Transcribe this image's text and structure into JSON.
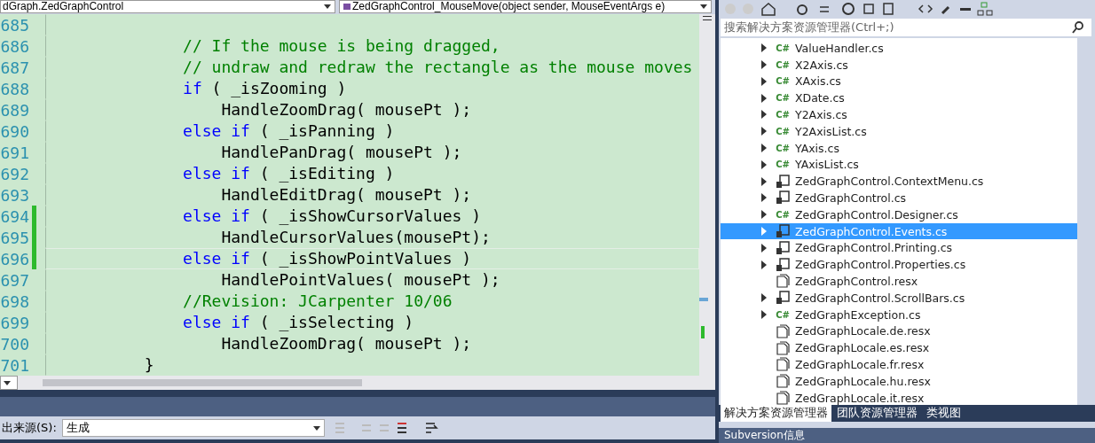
{
  "editor": {
    "type_dropdown": "dGraph.ZedGraphControl",
    "member_dropdown": "ZedGraphControl_MouseMove(object sender, MouseEventArgs e)",
    "lines": [
      {
        "number": "685",
        "changed": false,
        "current": false
      },
      {
        "number": "686",
        "changed": false,
        "current": false,
        "tokens": [
          {
            "kind": "comment",
            "text": "            // If the mouse is being dragged,"
          }
        ]
      },
      {
        "number": "687",
        "changed": false,
        "current": false,
        "tokens": [
          {
            "kind": "comment",
            "text": "            // undraw and redraw the rectangle as the mouse moves"
          }
        ]
      },
      {
        "number": "688",
        "changed": false,
        "current": false,
        "tokens": [
          {
            "kind": "keyword",
            "text": "            if"
          },
          {
            "kind": "plain",
            "text": " ( _isZooming )"
          }
        ]
      },
      {
        "number": "689",
        "changed": false,
        "current": false,
        "tokens": [
          {
            "kind": "plain",
            "text": "                HandleZoomDrag( mousePt );"
          }
        ]
      },
      {
        "number": "690",
        "changed": false,
        "current": false,
        "tokens": [
          {
            "kind": "keyword",
            "text": "            else if"
          },
          {
            "kind": "plain",
            "text": " ( _isPanning )"
          }
        ]
      },
      {
        "number": "691",
        "changed": false,
        "current": false,
        "tokens": [
          {
            "kind": "plain",
            "text": "                HandlePanDrag( mousePt );"
          }
        ]
      },
      {
        "number": "692",
        "changed": false,
        "current": false,
        "tokens": [
          {
            "kind": "keyword",
            "text": "            else if"
          },
          {
            "kind": "plain",
            "text": " ( _isEditing )"
          }
        ]
      },
      {
        "number": "693",
        "changed": false,
        "current": false,
        "tokens": [
          {
            "kind": "plain",
            "text": "                HandleEditDrag( mousePt );"
          }
        ]
      },
      {
        "number": "694",
        "changed": true,
        "current": false,
        "tokens": [
          {
            "kind": "keyword",
            "text": "            else if"
          },
          {
            "kind": "plain",
            "text": " ( _isShowCursorValues )"
          }
        ]
      },
      {
        "number": "695",
        "changed": true,
        "current": false,
        "tokens": [
          {
            "kind": "plain",
            "text": "                HandleCursorValues(mousePt);"
          }
        ]
      },
      {
        "number": "696",
        "changed": true,
        "current": true,
        "tokens": [
          {
            "kind": "keyword",
            "text": "            else if"
          },
          {
            "kind": "plain",
            "text": " ( _isShowPointValues )"
          }
        ]
      },
      {
        "number": "697",
        "changed": false,
        "current": false,
        "tokens": [
          {
            "kind": "plain",
            "text": "                HandlePointValues( mousePt );"
          }
        ]
      },
      {
        "number": "698",
        "changed": false,
        "current": false,
        "tokens": [
          {
            "kind": "comment",
            "text": "            //Revision: JCarpenter 10/06"
          }
        ]
      },
      {
        "number": "699",
        "changed": false,
        "current": false,
        "tokens": [
          {
            "kind": "keyword",
            "text": "            else if"
          },
          {
            "kind": "plain",
            "text": " ( _isSelecting )"
          }
        ]
      },
      {
        "number": "700",
        "changed": false,
        "current": false,
        "tokens": [
          {
            "kind": "plain",
            "text": "                HandleZoomDrag( mousePt );"
          }
        ]
      },
      {
        "number": "701",
        "changed": false,
        "current": false,
        "tokens": [
          {
            "kind": "plain",
            "text": "        }"
          }
        ]
      }
    ]
  },
  "output": {
    "source_label": "出来源(S):",
    "source_value": "生成"
  },
  "solution_explorer": {
    "search": {
      "placeholder": "搜索解决方案资源管理器(Ctrl+;)"
    },
    "items": [
      {
        "name": "ValueHandler.cs",
        "kind": "csharp",
        "icon_text": "C#",
        "expandable": true,
        "selected": false
      },
      {
        "name": "X2Axis.cs",
        "kind": "csharp",
        "icon_text": "C#",
        "expandable": true,
        "selected": false
      },
      {
        "name": "XAxis.cs",
        "kind": "csharp",
        "icon_text": "C#",
        "expandable": true,
        "selected": false
      },
      {
        "name": "XDate.cs",
        "kind": "csharp",
        "icon_text": "C#",
        "expandable": true,
        "selected": false
      },
      {
        "name": "Y2Axis.cs",
        "kind": "csharp",
        "icon_text": "C#",
        "expandable": true,
        "selected": false
      },
      {
        "name": "Y2AxisList.cs",
        "kind": "csharp",
        "icon_text": "C#",
        "expandable": true,
        "selected": false
      },
      {
        "name": "YAxis.cs",
        "kind": "csharp",
        "icon_text": "C#",
        "expandable": true,
        "selected": false
      },
      {
        "name": "YAxisList.cs",
        "kind": "csharp",
        "icon_text": "C#",
        "expandable": true,
        "selected": false
      },
      {
        "name": "ZedGraphControl.ContextMenu.cs",
        "kind": "control",
        "expandable": true,
        "selected": false
      },
      {
        "name": "ZedGraphControl.cs",
        "kind": "control",
        "expandable": true,
        "selected": false
      },
      {
        "name": "ZedGraphControl.Designer.cs",
        "kind": "csharp",
        "icon_text": "C#",
        "expandable": true,
        "selected": false
      },
      {
        "name": "ZedGraphControl.Events.cs",
        "kind": "control",
        "expandable": true,
        "selected": true
      },
      {
        "name": "ZedGraphControl.Printing.cs",
        "kind": "control",
        "expandable": true,
        "selected": false
      },
      {
        "name": "ZedGraphControl.Properties.cs",
        "kind": "control",
        "expandable": true,
        "selected": false
      },
      {
        "name": "ZedGraphControl.resx",
        "kind": "resx",
        "expandable": false,
        "selected": false
      },
      {
        "name": "ZedGraphControl.ScrollBars.cs",
        "kind": "control",
        "expandable": true,
        "selected": false
      },
      {
        "name": "ZedGraphException.cs",
        "kind": "csharp",
        "icon_text": "C#",
        "expandable": true,
        "selected": false
      },
      {
        "name": "ZedGraphLocale.de.resx",
        "kind": "resx",
        "expandable": false,
        "selected": false
      },
      {
        "name": "ZedGraphLocale.es.resx",
        "kind": "resx",
        "expandable": false,
        "selected": false
      },
      {
        "name": "ZedGraphLocale.fr.resx",
        "kind": "resx",
        "expandable": false,
        "selected": false
      },
      {
        "name": "ZedGraphLocale.hu.resx",
        "kind": "resx",
        "expandable": false,
        "selected": false
      },
      {
        "name": "ZedGraphLocale.it.resx",
        "kind": "resx",
        "expandable": false,
        "selected": false
      }
    ],
    "tabs": [
      {
        "label": "解决方案资源管理器",
        "selected": true
      },
      {
        "label": "团队资源管理器",
        "selected": false
      },
      {
        "label": "类视图",
        "selected": false
      }
    ],
    "bottom_panel_title": "Subversion信息"
  }
}
